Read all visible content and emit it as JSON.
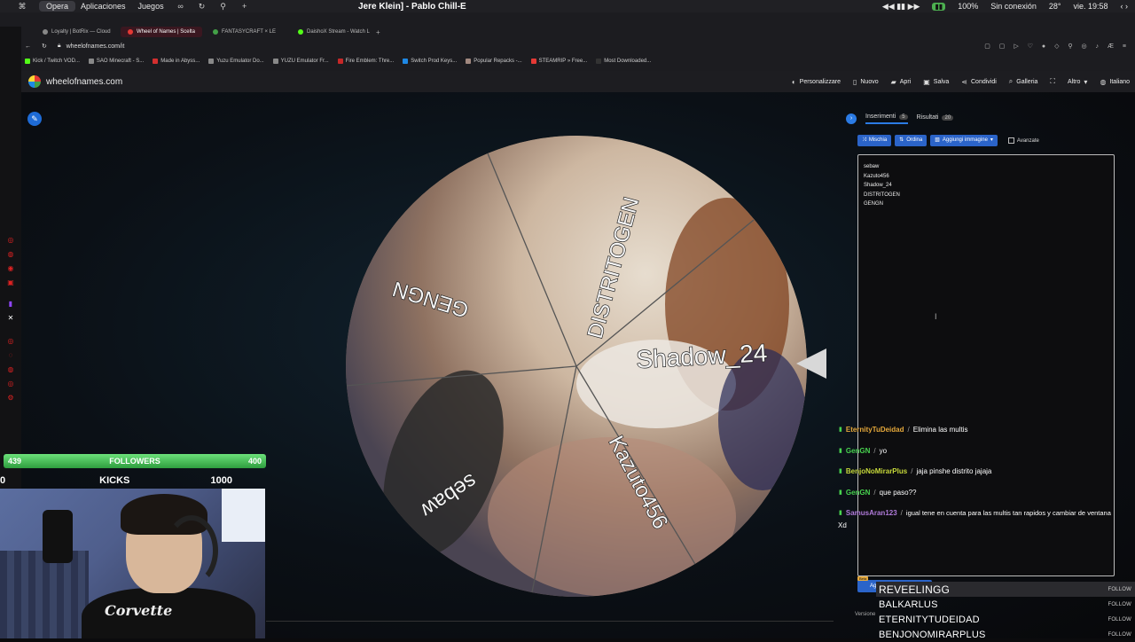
{
  "system": {
    "left_items": [
      "Opera",
      "Aplicaciones",
      "Juegos"
    ],
    "now_playing": "Jere Klein] - Pablo Chill-E",
    "battery": "100%",
    "wifi_status": "Sin conexión",
    "temperature": "28°",
    "clock": "vie. 19:58"
  },
  "browser": {
    "tabs": [
      {
        "label": "Loyalty | BotRix — Cloud"
      },
      {
        "label": "Wheel of Names | Scelta"
      },
      {
        "label": "FANTASYCRAFT × LE"
      },
      {
        "label": "DaishoX Stream - Watch L"
      }
    ],
    "address": "wheelofnames.com/it",
    "bookmarks": [
      "Kick / Twitch VOD...",
      "SAO Minecraft - S...",
      "Made in Abyss...",
      "Yuzu Emulator Do...",
      "YUZU Emulator Fr...",
      "Fire Emblem: Thre...",
      "Switch Prod Keys...",
      "Popular Repacks -...",
      "STEAMRIP » Free...",
      "Most Downloaded..."
    ]
  },
  "site": {
    "name": "wheelofnames.com",
    "menu": [
      {
        "icon": "palette-icon",
        "label": "Personalizzare"
      },
      {
        "icon": "file-icon",
        "label": "Nuovo"
      },
      {
        "icon": "folder-icon",
        "label": "Apri"
      },
      {
        "icon": "save-icon",
        "label": "Salva"
      },
      {
        "icon": "share-icon",
        "label": "Condividi"
      },
      {
        "icon": "search-icon",
        "label": "Galleria"
      },
      {
        "icon": "fullscreen-icon",
        "label": ""
      },
      {
        "icon": "chevron-down-icon",
        "label": "Altro"
      },
      {
        "icon": "globe-icon",
        "label": "Italiano"
      }
    ]
  },
  "wheel": {
    "segments": [
      "DISTRITOGEN",
      "Shadow_24",
      "Kazuto456",
      "sebaw",
      "GENGN"
    ]
  },
  "panel": {
    "tab_entries": "Inserimenti",
    "tab_entries_count": "5",
    "tab_results": "Risultati",
    "tab_results_count": "20",
    "btn_shuffle": "Mischia",
    "btn_sort": "Ordina",
    "btn_add_image": "Aggiungi immagine",
    "advanced": "Avanzate",
    "entries": [
      "sebaw",
      "Kazuto456",
      "Shadow_24",
      "DISTRITOGEN",
      "GENGN"
    ],
    "beta": "Beta",
    "add_more": "Aggiungi extra",
    "version": "Versione"
  },
  "chat": [
    {
      "user": "EternityTuDeidad",
      "color": "#e5a83b",
      "text": "Elimina las multis"
    },
    {
      "user": "GenGN",
      "color": "#48d34f",
      "text": "yo"
    },
    {
      "user": "BenjoNoMirarPlus",
      "color": "#c7d93a",
      "text": "jaja pinshe distrito jajaja"
    },
    {
      "user": "GenGN",
      "color": "#48d34f",
      "text": "que paso??"
    },
    {
      "user": "SamusAran123",
      "color": "#b07ad9",
      "text": "igual tene en cuenta para las multis tan rapidos y cambiar de ventana"
    }
  ],
  "chat_tail": "Xd",
  "follows": [
    {
      "name": "REVEELINGG",
      "label": "FOLLOW"
    },
    {
      "name": "BALKARLUS",
      "label": "FOLLOW"
    },
    {
      "name": "ETERNITYTUDEIDAD",
      "label": "FOLLOW"
    },
    {
      "name": "BENJONOMIRARPLUS",
      "label": "FOLLOW"
    }
  ],
  "stream": {
    "followers_current": "439",
    "followers_label": "FOLLOWERS",
    "followers_goal": "400",
    "kicks_current": "0",
    "kicks_label": "KICKS",
    "kicks_goal": "1000",
    "shirt_text": "Corvette"
  }
}
